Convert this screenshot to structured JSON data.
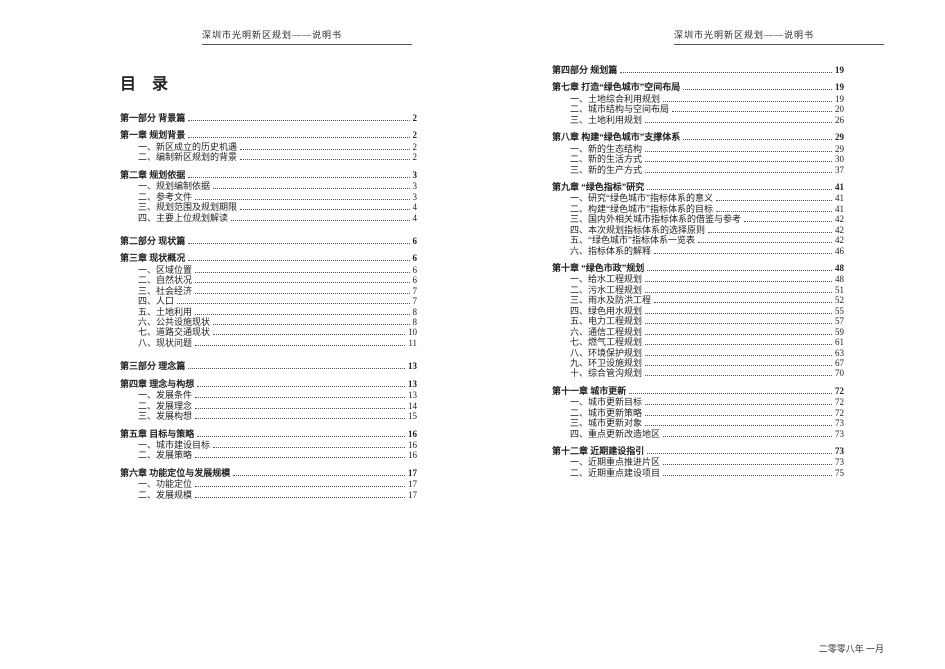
{
  "header": {
    "running_head": "深圳市光明新区规划——说明书"
  },
  "footer": {
    "date": "二零零八年  一月"
  },
  "title": "目  录",
  "toc_left": [
    {
      "level": "part",
      "label": "第一部分  背景篇",
      "page": "2"
    },
    {
      "level": "chapter",
      "label": "第一章  规划背景",
      "page": "2"
    },
    {
      "level": "item",
      "label": "一、新区成立的历史机遇",
      "page": "2"
    },
    {
      "level": "item",
      "label": "二、编制新区规划的背景",
      "page": "2"
    },
    {
      "level": "chapter",
      "label": "第二章  规划依据",
      "page": "3"
    },
    {
      "level": "item",
      "label": "一、规划编制依据",
      "page": "3"
    },
    {
      "level": "item",
      "label": "二、参考文件",
      "page": "3"
    },
    {
      "level": "item",
      "label": "三、规划范围及规划期限",
      "page": "4"
    },
    {
      "level": "item",
      "label": "四、主要上位规划解读",
      "page": "4"
    },
    {
      "level": "part",
      "label": "第二部分  现状篇",
      "page": "6"
    },
    {
      "level": "chapter",
      "label": "第三章  现状概况",
      "page": "6"
    },
    {
      "level": "item",
      "label": "一、区域位置",
      "page": "6"
    },
    {
      "level": "item",
      "label": "二、自然状况",
      "page": "6"
    },
    {
      "level": "item",
      "label": "三、社会经济",
      "page": "7"
    },
    {
      "level": "item",
      "label": "四、人口",
      "page": "7"
    },
    {
      "level": "item",
      "label": "五、土地利用",
      "page": "8"
    },
    {
      "level": "item",
      "label": "六、公共设施现状",
      "page": "8"
    },
    {
      "level": "item",
      "label": "七、道路交通现状",
      "page": "10"
    },
    {
      "level": "item",
      "label": "八、现状问题",
      "page": "11"
    },
    {
      "level": "part",
      "label": "第三部分  理念篇",
      "page": "13"
    },
    {
      "level": "chapter",
      "label": "第四章  理念与构想",
      "page": "13"
    },
    {
      "level": "item",
      "label": "一、发展条件",
      "page": "13"
    },
    {
      "level": "item",
      "label": "二、发展理念",
      "page": "14"
    },
    {
      "level": "item",
      "label": "三、发展构想",
      "page": "15"
    },
    {
      "level": "chapter",
      "label": "第五章  目标与策略",
      "page": "16"
    },
    {
      "level": "item",
      "label": "一、城市建设目标",
      "page": "16"
    },
    {
      "level": "item",
      "label": "二、发展策略",
      "page": "16"
    },
    {
      "level": "chapter",
      "label": "第六章  功能定位与发展规模",
      "page": "17"
    },
    {
      "level": "item",
      "label": "一、功能定位",
      "page": "17"
    },
    {
      "level": "item",
      "label": "二、发展规模",
      "page": "17"
    }
  ],
  "toc_right": [
    {
      "level": "part",
      "label": "第四部分  规划篇",
      "page": "19"
    },
    {
      "level": "chapter",
      "label": "第七章  打造“绿色城市”空间布局",
      "page": "19"
    },
    {
      "level": "item",
      "label": "一、土地综合利用规划",
      "page": "19"
    },
    {
      "level": "item",
      "label": "二、城市结构与空间布局",
      "page": "20"
    },
    {
      "level": "item",
      "label": "三、土地利用规划",
      "page": "26"
    },
    {
      "level": "chapter",
      "label": "第八章  构建“绿色城市”支撑体系",
      "page": "29"
    },
    {
      "level": "item",
      "label": "一、新的生态结构",
      "page": "29"
    },
    {
      "level": "item",
      "label": "二、新的生活方式",
      "page": "30"
    },
    {
      "level": "item",
      "label": "三、新的生产方式",
      "page": "37"
    },
    {
      "level": "chapter",
      "label": "第九章  “绿色指标”研究",
      "page": "41"
    },
    {
      "level": "item",
      "label": "一、研究“绿色城市”指标体系的意义",
      "page": "41"
    },
    {
      "level": "item",
      "label": "二、构建“绿色城市”指标体系的目标",
      "page": "41"
    },
    {
      "level": "item",
      "label": "三、国内外相关城市指标体系的借鉴与参考",
      "page": "42"
    },
    {
      "level": "item",
      "label": "四、本次规划指标体系的选择原则",
      "page": "42"
    },
    {
      "level": "item",
      "label": "五、“绿色城市”指标体系一览表",
      "page": "42"
    },
    {
      "level": "item",
      "label": "六、指标体系的解释",
      "page": "46"
    },
    {
      "level": "chapter",
      "label": "第十章  “绿色市政”规划",
      "page": "48"
    },
    {
      "level": "item",
      "label": "一、给水工程规划",
      "page": "48"
    },
    {
      "level": "item",
      "label": "二、污水工程规划",
      "page": "51"
    },
    {
      "level": "item",
      "label": "三、雨水及防洪工程",
      "page": "52"
    },
    {
      "level": "item",
      "label": "四、绿色用水规划",
      "page": "55"
    },
    {
      "level": "item",
      "label": "五、电力工程规划",
      "page": "57"
    },
    {
      "level": "item",
      "label": "六、通信工程规划",
      "page": "59"
    },
    {
      "level": "item",
      "label": "七、燃气工程规划",
      "page": "61"
    },
    {
      "level": "item",
      "label": "八、环境保护规划",
      "page": "63"
    },
    {
      "level": "item",
      "label": "九、环卫设施规划",
      "page": "67"
    },
    {
      "level": "item",
      "label": "十、综合管沟规划",
      "page": "70"
    },
    {
      "level": "chapter",
      "label": "第十一章  城市更新",
      "page": "72"
    },
    {
      "level": "item",
      "label": "一、城市更新目标",
      "page": "72"
    },
    {
      "level": "item",
      "label": "二、城市更新策略",
      "page": "72"
    },
    {
      "level": "item",
      "label": "三、城市更新对象",
      "page": "73"
    },
    {
      "level": "item",
      "label": "四、重点更新改造地区",
      "page": "73"
    },
    {
      "level": "chapter",
      "label": "第十二章  近期建设指引",
      "page": "73"
    },
    {
      "level": "item",
      "label": "一、近期重点推进片区",
      "page": "73"
    },
    {
      "level": "item",
      "label": "二、近期重点建设项目",
      "page": "75"
    }
  ]
}
